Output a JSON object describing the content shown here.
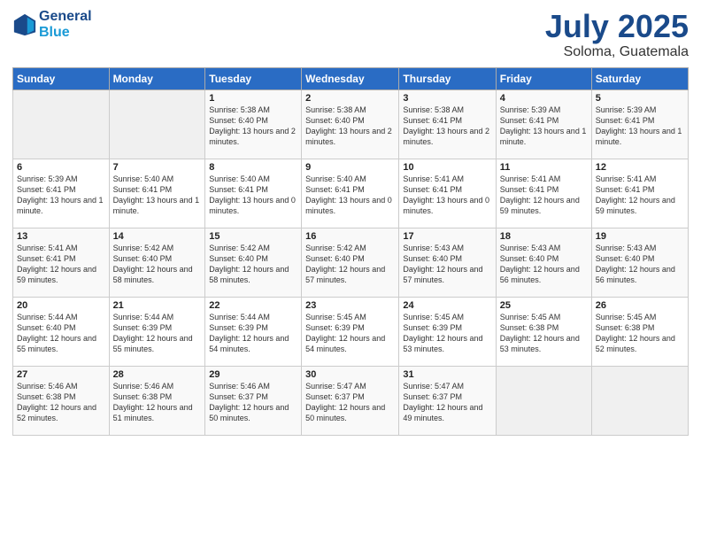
{
  "logo": {
    "line1": "General",
    "line2": "Blue"
  },
  "title": {
    "month": "July 2025",
    "location": "Soloma, Guatemala"
  },
  "weekdays": [
    "Sunday",
    "Monday",
    "Tuesday",
    "Wednesday",
    "Thursday",
    "Friday",
    "Saturday"
  ],
  "weeks": [
    [
      {
        "day": "",
        "sunrise": "",
        "sunset": "",
        "daylight": ""
      },
      {
        "day": "",
        "sunrise": "",
        "sunset": "",
        "daylight": ""
      },
      {
        "day": "1",
        "sunrise": "Sunrise: 5:38 AM",
        "sunset": "Sunset: 6:40 PM",
        "daylight": "Daylight: 13 hours and 2 minutes."
      },
      {
        "day": "2",
        "sunrise": "Sunrise: 5:38 AM",
        "sunset": "Sunset: 6:40 PM",
        "daylight": "Daylight: 13 hours and 2 minutes."
      },
      {
        "day": "3",
        "sunrise": "Sunrise: 5:38 AM",
        "sunset": "Sunset: 6:41 PM",
        "daylight": "Daylight: 13 hours and 2 minutes."
      },
      {
        "day": "4",
        "sunrise": "Sunrise: 5:39 AM",
        "sunset": "Sunset: 6:41 PM",
        "daylight": "Daylight: 13 hours and 1 minute."
      },
      {
        "day": "5",
        "sunrise": "Sunrise: 5:39 AM",
        "sunset": "Sunset: 6:41 PM",
        "daylight": "Daylight: 13 hours and 1 minute."
      }
    ],
    [
      {
        "day": "6",
        "sunrise": "Sunrise: 5:39 AM",
        "sunset": "Sunset: 6:41 PM",
        "daylight": "Daylight: 13 hours and 1 minute."
      },
      {
        "day": "7",
        "sunrise": "Sunrise: 5:40 AM",
        "sunset": "Sunset: 6:41 PM",
        "daylight": "Daylight: 13 hours and 1 minute."
      },
      {
        "day": "8",
        "sunrise": "Sunrise: 5:40 AM",
        "sunset": "Sunset: 6:41 PM",
        "daylight": "Daylight: 13 hours and 0 minutes."
      },
      {
        "day": "9",
        "sunrise": "Sunrise: 5:40 AM",
        "sunset": "Sunset: 6:41 PM",
        "daylight": "Daylight: 13 hours and 0 minutes."
      },
      {
        "day": "10",
        "sunrise": "Sunrise: 5:41 AM",
        "sunset": "Sunset: 6:41 PM",
        "daylight": "Daylight: 13 hours and 0 minutes."
      },
      {
        "day": "11",
        "sunrise": "Sunrise: 5:41 AM",
        "sunset": "Sunset: 6:41 PM",
        "daylight": "Daylight: 12 hours and 59 minutes."
      },
      {
        "day": "12",
        "sunrise": "Sunrise: 5:41 AM",
        "sunset": "Sunset: 6:41 PM",
        "daylight": "Daylight: 12 hours and 59 minutes."
      }
    ],
    [
      {
        "day": "13",
        "sunrise": "Sunrise: 5:41 AM",
        "sunset": "Sunset: 6:41 PM",
        "daylight": "Daylight: 12 hours and 59 minutes."
      },
      {
        "day": "14",
        "sunrise": "Sunrise: 5:42 AM",
        "sunset": "Sunset: 6:40 PM",
        "daylight": "Daylight: 12 hours and 58 minutes."
      },
      {
        "day": "15",
        "sunrise": "Sunrise: 5:42 AM",
        "sunset": "Sunset: 6:40 PM",
        "daylight": "Daylight: 12 hours and 58 minutes."
      },
      {
        "day": "16",
        "sunrise": "Sunrise: 5:42 AM",
        "sunset": "Sunset: 6:40 PM",
        "daylight": "Daylight: 12 hours and 57 minutes."
      },
      {
        "day": "17",
        "sunrise": "Sunrise: 5:43 AM",
        "sunset": "Sunset: 6:40 PM",
        "daylight": "Daylight: 12 hours and 57 minutes."
      },
      {
        "day": "18",
        "sunrise": "Sunrise: 5:43 AM",
        "sunset": "Sunset: 6:40 PM",
        "daylight": "Daylight: 12 hours and 56 minutes."
      },
      {
        "day": "19",
        "sunrise": "Sunrise: 5:43 AM",
        "sunset": "Sunset: 6:40 PM",
        "daylight": "Daylight: 12 hours and 56 minutes."
      }
    ],
    [
      {
        "day": "20",
        "sunrise": "Sunrise: 5:44 AM",
        "sunset": "Sunset: 6:40 PM",
        "daylight": "Daylight: 12 hours and 55 minutes."
      },
      {
        "day": "21",
        "sunrise": "Sunrise: 5:44 AM",
        "sunset": "Sunset: 6:39 PM",
        "daylight": "Daylight: 12 hours and 55 minutes."
      },
      {
        "day": "22",
        "sunrise": "Sunrise: 5:44 AM",
        "sunset": "Sunset: 6:39 PM",
        "daylight": "Daylight: 12 hours and 54 minutes."
      },
      {
        "day": "23",
        "sunrise": "Sunrise: 5:45 AM",
        "sunset": "Sunset: 6:39 PM",
        "daylight": "Daylight: 12 hours and 54 minutes."
      },
      {
        "day": "24",
        "sunrise": "Sunrise: 5:45 AM",
        "sunset": "Sunset: 6:39 PM",
        "daylight": "Daylight: 12 hours and 53 minutes."
      },
      {
        "day": "25",
        "sunrise": "Sunrise: 5:45 AM",
        "sunset": "Sunset: 6:38 PM",
        "daylight": "Daylight: 12 hours and 53 minutes."
      },
      {
        "day": "26",
        "sunrise": "Sunrise: 5:45 AM",
        "sunset": "Sunset: 6:38 PM",
        "daylight": "Daylight: 12 hours and 52 minutes."
      }
    ],
    [
      {
        "day": "27",
        "sunrise": "Sunrise: 5:46 AM",
        "sunset": "Sunset: 6:38 PM",
        "daylight": "Daylight: 12 hours and 52 minutes."
      },
      {
        "day": "28",
        "sunrise": "Sunrise: 5:46 AM",
        "sunset": "Sunset: 6:38 PM",
        "daylight": "Daylight: 12 hours and 51 minutes."
      },
      {
        "day": "29",
        "sunrise": "Sunrise: 5:46 AM",
        "sunset": "Sunset: 6:37 PM",
        "daylight": "Daylight: 12 hours and 50 minutes."
      },
      {
        "day": "30",
        "sunrise": "Sunrise: 5:47 AM",
        "sunset": "Sunset: 6:37 PM",
        "daylight": "Daylight: 12 hours and 50 minutes."
      },
      {
        "day": "31",
        "sunrise": "Sunrise: 5:47 AM",
        "sunset": "Sunset: 6:37 PM",
        "daylight": "Daylight: 12 hours and 49 minutes."
      },
      {
        "day": "",
        "sunrise": "",
        "sunset": "",
        "daylight": ""
      },
      {
        "day": "",
        "sunrise": "",
        "sunset": "",
        "daylight": ""
      }
    ]
  ]
}
